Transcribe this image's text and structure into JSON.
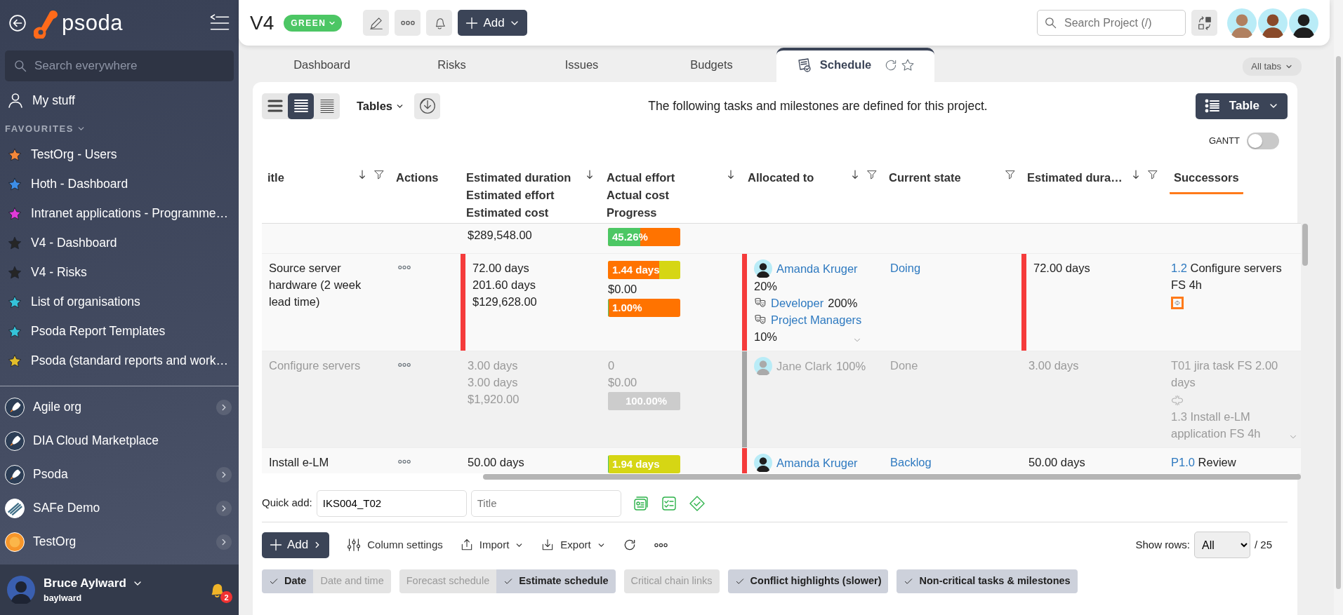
{
  "sidebar": {
    "app_name": "psoda",
    "search": {
      "placeholder": "Search everywhere"
    },
    "my_stuff": "My stuff",
    "favourites_heading": "FAVOURITES",
    "favourites": [
      {
        "label": "TestOrg - Users",
        "color": "#f5883a"
      },
      {
        "label": "Hoth - Dashboard",
        "color": "#3d8ee8"
      },
      {
        "label": "Intranet applications - Programme…",
        "color": "#e03ad8"
      },
      {
        "label": "V4 - Dashboard",
        "color": "#262626"
      },
      {
        "label": "V4 - Risks",
        "color": "#262626"
      },
      {
        "label": "List of organisations",
        "color": "#35c3d9"
      },
      {
        "label": "Psoda Report Templates",
        "color": "#35c3d9"
      },
      {
        "label": "Psoda (standard reports and work…",
        "color": "#e2bd2a"
      }
    ],
    "organisations": [
      {
        "label": "Agile org",
        "kind": "rocket",
        "expandable": true
      },
      {
        "label": "DIA Cloud Marketplace",
        "kind": "rocket",
        "expandable": false
      },
      {
        "label": "Psoda",
        "kind": "rocket",
        "expandable": true
      },
      {
        "label": "SAFe Demo",
        "kind": "stripes",
        "expandable": true
      },
      {
        "label": "TestOrg",
        "kind": "sun",
        "expandable": true
      }
    ],
    "user": {
      "name": "Bruce Aylward",
      "username": "baylward",
      "notifications": "2"
    }
  },
  "header": {
    "title": "V4",
    "status": "GREEN",
    "add_button": "Add",
    "search": {
      "placeholder": "Search Project (/)"
    }
  },
  "tabs": [
    {
      "label": "Dashboard",
      "selected": false
    },
    {
      "label": "Risks",
      "selected": false
    },
    {
      "label": "Issues",
      "selected": false
    },
    {
      "label": "Budgets",
      "selected": false
    },
    {
      "label": "Schedule",
      "selected": true
    }
  ],
  "all_tabs": "All tabs",
  "toolbar": {
    "density": [
      {
        "selected": false
      },
      {
        "selected": true
      },
      {
        "selected": false
      }
    ],
    "tables": "Tables",
    "description": "The following tasks and milestones are defined for this project.",
    "view_button": "Table",
    "gantt": {
      "label": "GANTT",
      "on": false
    }
  },
  "table": {
    "columns": [
      {
        "lines": [
          "itle"
        ],
        "sortable": true,
        "filterable": true,
        "selected": false
      },
      {
        "lines": [
          "Actions"
        ],
        "sortable": false,
        "filterable": false,
        "selected": false
      },
      {
        "lines": [
          "Estimated duration",
          "Estimated effort",
          "Estimated cost"
        ],
        "sortable": true,
        "filterable": false,
        "selected": false
      },
      {
        "lines": [
          "Actual effort",
          "Actual cost",
          "Progress"
        ],
        "sortable": true,
        "filterable": false,
        "selected": false
      },
      {
        "lines": [
          "Allocated to"
        ],
        "sortable": true,
        "filterable": true,
        "selected": false
      },
      {
        "lines": [
          "Current state"
        ],
        "sortable": false,
        "filterable": true,
        "selected": false
      },
      {
        "lines": [
          "Estimated dura…"
        ],
        "sortable": true,
        "filterable": true,
        "selected": false
      },
      {
        "lines": [
          "Successors"
        ],
        "sortable": false,
        "filterable": false,
        "selected": true
      }
    ],
    "rows": [
      {
        "done": false,
        "has_actions": false,
        "estimated": [
          "$289,548.00"
        ],
        "actual": [
          {
            "kind": "bar",
            "text": "45.26%",
            "level": 0.45,
            "color": "#4cc764",
            "track": {
              "color": "#ff7300"
            }
          }
        ],
        "allocation": [],
        "more_allocation": false,
        "duration_conflict": false,
        "allocation_conflict": false,
        "estimate_conflict": false,
        "successors": [],
        "more_successors": false
      },
      {
        "done": false,
        "has_actions": true,
        "title": "Source server hardware (2 week lead time)",
        "estimated": [
          "72.00 days",
          "201.60 days",
          "$129,628.00"
        ],
        "actual": [
          {
            "kind": "bar",
            "text": "1.44 days",
            "level": 0.71,
            "color": "#ff7300",
            "track": {
              "color": "#d6d614"
            }
          },
          {
            "kind": "text",
            "text": "$0.00"
          },
          {
            "kind": "bar",
            "text": "1.00%",
            "level": 0.01,
            "color": "#4cc764",
            "track": {
              "color": "#ff7300"
            }
          }
        ],
        "allocation": [
          {
            "kind": "person",
            "name": "Amanda Kruger"
          },
          {
            "kind": "text",
            "text": "20%"
          },
          {
            "kind": "role",
            "name": "Developer",
            "suffix": "200%"
          },
          {
            "kind": "role",
            "name": "Project Managers"
          },
          {
            "kind": "text",
            "text": "10%"
          }
        ],
        "more_allocation": true,
        "state": "Doing",
        "estimated_duration": "72.00 days",
        "duration_conflict": true,
        "allocation_conflict": true,
        "estimate_conflict": true,
        "successors": [
          {
            "kind": "link",
            "code": "1.2",
            "text": "Configure servers FS 4h"
          },
          {
            "kind": "break",
            "highlighted": true
          }
        ],
        "more_successors": false
      },
      {
        "done": true,
        "has_actions": true,
        "title": "Configure servers",
        "estimated": [
          "3.00 days",
          "3.00 days",
          "$1,920.00"
        ],
        "actual": [
          {
            "kind": "text",
            "text": "0"
          },
          {
            "kind": "text",
            "text": "$0.00"
          },
          {
            "kind": "bar",
            "text": "100.00%",
            "level": 1,
            "color": "#cccccc",
            "track": {
              "color": "#cccccc"
            }
          }
        ],
        "allocation": [
          {
            "kind": "person",
            "name": "Jane Clark",
            "suffix": "100%"
          }
        ],
        "more_allocation": false,
        "state": "Done",
        "estimated_duration": "3.00 days",
        "duration_conflict": false,
        "allocation_conflict": false,
        "estimate_conflict": false,
        "successors": [
          {
            "kind": "link",
            "code": "T01",
            "text": "jira task FS 2.00 days"
          },
          {
            "kind": "break",
            "highlighted": false
          },
          {
            "kind": "link",
            "code": "1.3",
            "text": "Install e-LM application FS 4h"
          }
        ],
        "more_successors": true
      },
      {
        "done": false,
        "has_actions": true,
        "title": "Install e-LM",
        "estimated": [
          "50.00 days"
        ],
        "actual": [
          {
            "kind": "bar",
            "text": "1.94 days",
            "level": 0.01,
            "color": "#4cc764",
            "track": {
              "color": "#d6d614"
            }
          }
        ],
        "allocation": [
          {
            "kind": "person",
            "name": "Amanda Kruger"
          }
        ],
        "more_allocation": false,
        "state": "Backlog",
        "estimated_duration": "50.00 days",
        "duration_conflict": false,
        "allocation_conflict": true,
        "estimate_conflict": false,
        "successors": [
          {
            "kind": "link",
            "code": "P1.0",
            "text": "Review"
          }
        ],
        "more_successors": false
      }
    ]
  },
  "quick_add": {
    "label": "Quick add:",
    "code": "IKS004_T02",
    "title_placeholder": "Title"
  },
  "actions": {
    "add": "Add",
    "column_settings": "Column settings",
    "import": "Import",
    "export": "Export",
    "show_rows_label": "Show rows:",
    "show_rows": "All",
    "total": "/ 25"
  },
  "filters": [
    {
      "chips": [
        {
          "label": "Date",
          "checked": true
        },
        {
          "label": "Date and time",
          "checked": false
        }
      ]
    },
    {
      "chips": [
        {
          "label": "Forecast schedule",
          "checked": false
        },
        {
          "label": "Estimate schedule",
          "checked": true
        }
      ]
    },
    {
      "chips": [
        {
          "label": "Critical chain links",
          "checked": false
        }
      ]
    },
    {
      "chips": [
        {
          "label": "Conflict highlights (slower)",
          "checked": true
        }
      ]
    },
    {
      "chips": [
        {
          "label": "Non-critical tasks & milestones",
          "checked": true
        }
      ]
    }
  ]
}
